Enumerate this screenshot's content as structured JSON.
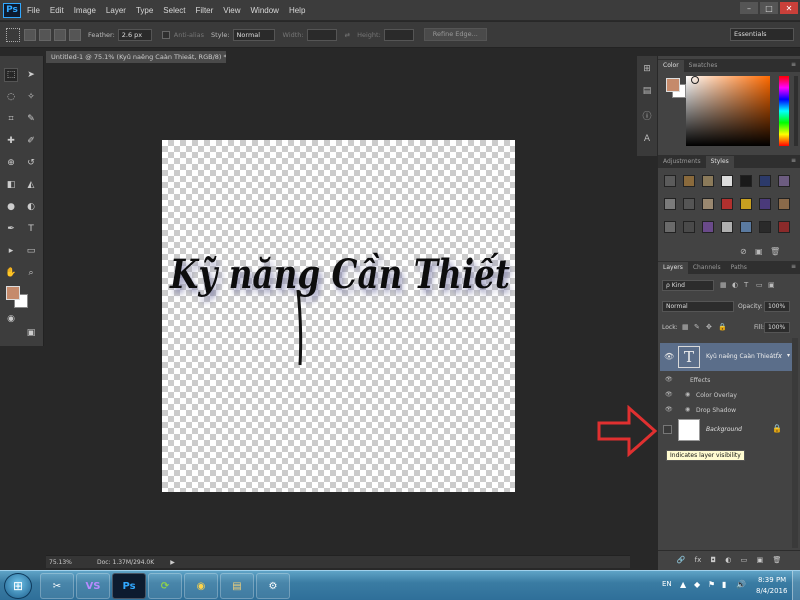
{
  "app": {
    "logo": "Ps"
  },
  "menubar": {
    "items": [
      "File",
      "Edit",
      "Image",
      "Layer",
      "Type",
      "Select",
      "Filter",
      "View",
      "Window",
      "Help"
    ],
    "window_controls": [
      "–",
      "□",
      "✕"
    ]
  },
  "options_bar": {
    "feather_label": "Feather:",
    "feather_value": "2.6 px",
    "antialias_label": "Anti-alias",
    "style_label": "Style:",
    "style_value": "Normal",
    "width_label": "Width:",
    "height_label": "Height:",
    "refine_edge_label": "Refine Edge...",
    "workspace": "Essentials"
  },
  "document": {
    "tab_title": "Untitled-1 @ 75.1% (Kyû naêng Caàn Thieát, RGB/8) *",
    "canvas_text": "Kỹ năng Cần Thiết",
    "text_color": "#111111"
  },
  "statusbar": {
    "zoom": "75.13%",
    "doc_size": "Doc: 1.37M/294.0K"
  },
  "color_panel": {
    "tabs": [
      "Color",
      "Swatches"
    ],
    "foreground": "#c58a6b",
    "background": "#ffffff"
  },
  "styles_panel": {
    "tabs": [
      "Adjustments",
      "Styles"
    ],
    "swatches": [
      "#5b5b5b",
      "#8a6a3c",
      "#8b7a5a",
      "#dcdcdc",
      "#1a1a1a",
      "#2c3a6a",
      "#6c5c80",
      "#7a7a7a",
      "#555555",
      "#9a8870",
      "#b0302e",
      "#c8a020",
      "#4a3a7a",
      "#8a6a4a",
      "#6a6a6a",
      "#4a4a4a",
      "#6a4a8a",
      "#b0b0b0",
      "#5a7aa0",
      "#2a2a2a",
      "#8a2a2a"
    ]
  },
  "layers_panel": {
    "tabs": [
      "Layers",
      "Channels",
      "Paths"
    ],
    "filter_label": "ρ Kind",
    "blend_mode": "Normal",
    "opacity_label": "Opacity:",
    "opacity_value": "100%",
    "lock_label": "Lock:",
    "fill_label": "Fill:",
    "fill_value": "100%",
    "text_layer_name": "Kyû naêng Caàn Thieát",
    "effects_label": "Effects",
    "effect_1": "Color Overlay",
    "effect_2": "Drop Shadow",
    "background_layer_name": "Background",
    "tooltip": "Indicates layer visibility"
  },
  "taskbar": {
    "apps": [
      "✂",
      "VS",
      "Ps",
      "⟳",
      "◉",
      "▤",
      "⚙"
    ],
    "language": "EN",
    "time": "8:39 PM",
    "date": "8/4/2016"
  },
  "accent": {
    "selected_layer": "#5b6e8a",
    "annotation_arrow": "#e03030"
  }
}
